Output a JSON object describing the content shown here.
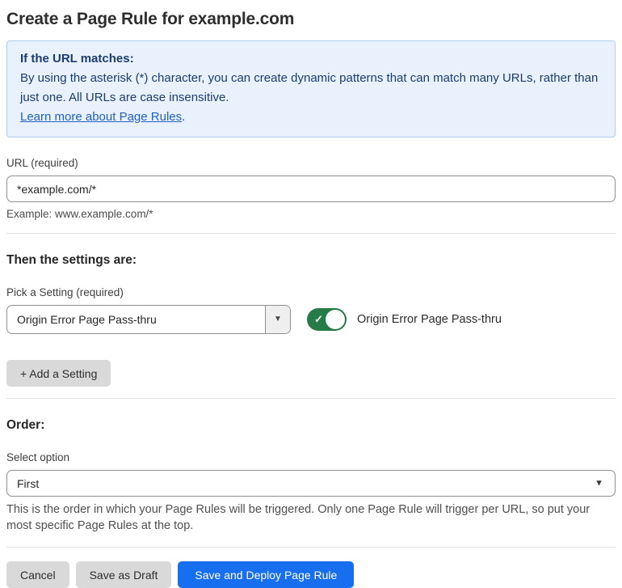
{
  "page": {
    "title": "Create a Page Rule for example.com"
  },
  "info_box": {
    "heading": "If the URL matches:",
    "body": "By using the asterisk (*) character, you can create dynamic patterns that can match many URLs, rather than just one. All URLs are case insensitive.",
    "link_label": "Learn more about Page Rules",
    "link_suffix": "."
  },
  "url_field": {
    "label": "URL (required)",
    "value": "*example.com/*",
    "example": "Example: www.example.com/*"
  },
  "settings_section": {
    "heading": "Then the settings are:",
    "picker_label": "Pick a Setting (required)",
    "picker_value": "Origin Error Page Pass-thru",
    "caret_icon": "▼",
    "toggle": {
      "state": "on",
      "check_icon": "✓",
      "label": "Origin Error Page Pass-thru"
    },
    "add_button_label": "+ Add a Setting"
  },
  "order_section": {
    "heading": "Order:",
    "select_label": "Select option",
    "select_value": "First",
    "caret_icon": "▼",
    "help_text": "This is the order in which your Page Rules will be triggered. Only one Page Rule will trigger per URL, so put your most specific Page Rules at the top."
  },
  "footer": {
    "cancel_label": "Cancel",
    "save_draft_label": "Save as Draft",
    "save_deploy_label": "Save and Deploy Page Rule"
  },
  "colors": {
    "info_background": "#e8f1fc",
    "info_border": "#b0cdee",
    "info_text": "#1d3c70",
    "link_blue": "#2060cc",
    "toggle_green": "#267c46",
    "primary_button_blue": "#176ff0",
    "secondary_button_gray": "#d9d9d9",
    "input_border": "#8f8f8f",
    "divider": "#e0e0e0"
  }
}
